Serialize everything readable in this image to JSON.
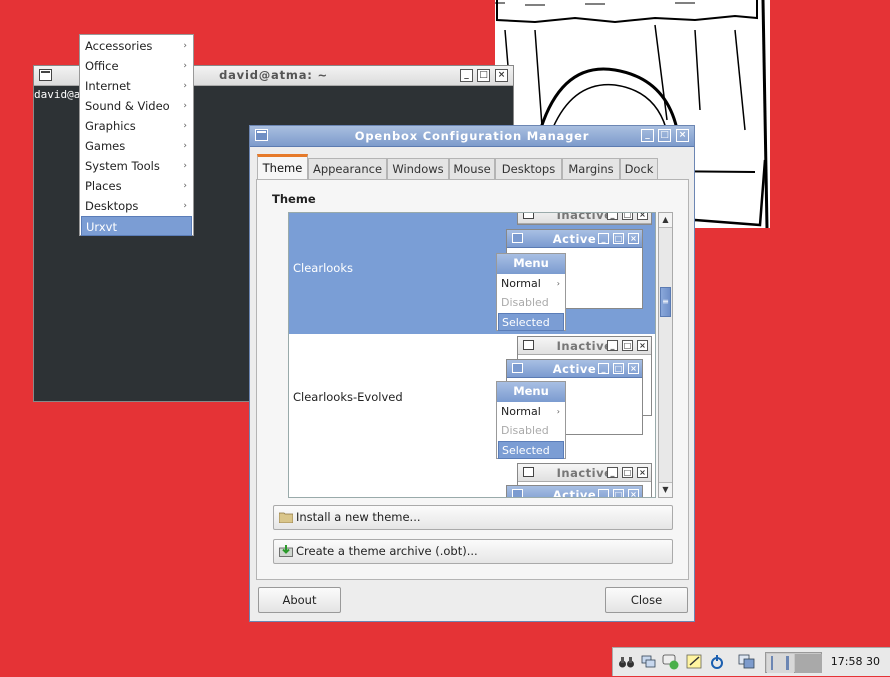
{
  "terminal": {
    "title": "david@atma: ~",
    "prompt": "david@atma:~$ "
  },
  "root_menu": {
    "items": [
      {
        "label": "Accessories",
        "submenu": true
      },
      {
        "label": "Office",
        "submenu": true
      },
      {
        "label": "Internet",
        "submenu": true
      },
      {
        "label": "Sound & Video",
        "submenu": true
      },
      {
        "label": "Graphics",
        "submenu": true
      },
      {
        "label": "Games",
        "submenu": true
      },
      {
        "label": "System Tools",
        "submenu": true
      },
      {
        "label": "Places",
        "submenu": true
      },
      {
        "label": "Desktops",
        "submenu": true
      },
      {
        "label": "Urxvt",
        "submenu": false,
        "selected": true
      }
    ]
  },
  "obconf": {
    "title": "Openbox Configuration Manager",
    "tabs": [
      {
        "label": "Theme",
        "active": true
      },
      {
        "label": "Appearance"
      },
      {
        "label": "Windows"
      },
      {
        "label": "Mouse"
      },
      {
        "label": "Desktops"
      },
      {
        "label": "Margins"
      },
      {
        "label": "Dock"
      }
    ],
    "theme_header": "Theme",
    "preview": {
      "inactive": "Inactive",
      "active": "Active",
      "menu": "Menu",
      "normal": "Normal",
      "disabled": "Disabled",
      "selected": "Selected"
    },
    "themes": [
      {
        "name": "Clearlooks",
        "selected": true
      },
      {
        "name": "Clearlooks-Evolved",
        "selected": false
      },
      {
        "name": "",
        "selected": false
      }
    ],
    "install_label": "Install a new theme...",
    "archive_label": "Create a theme archive (.obt)...",
    "about_label": "About",
    "close_label": "Close"
  },
  "taskbar": {
    "clock": "17:58 30"
  },
  "colors": {
    "desktop": "#e53336",
    "title_active": "#7d9bcc",
    "selection": "#7a9ed6",
    "tab_accent": "#e67a2a"
  }
}
